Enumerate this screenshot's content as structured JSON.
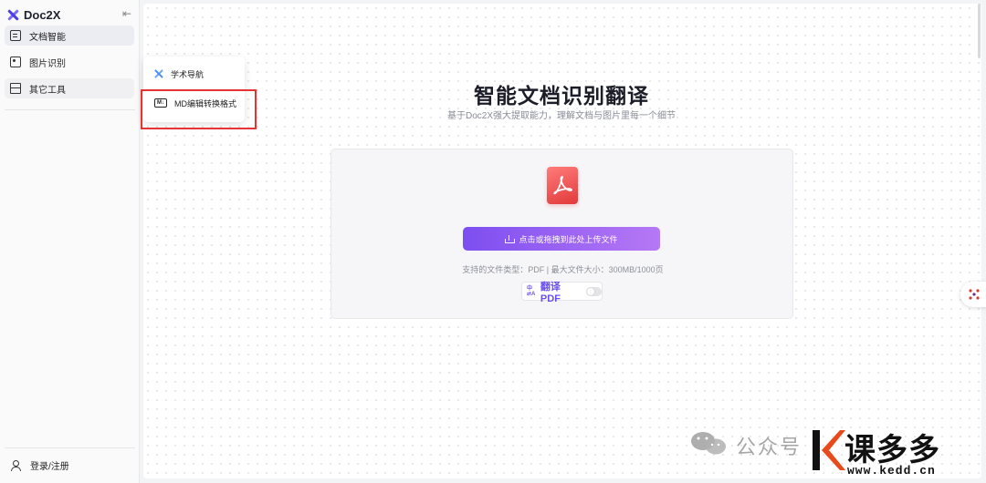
{
  "sidebar": {
    "brand": "Doc2X",
    "collapse_icon": "collapse-left-icon",
    "items": [
      {
        "label": "文档智能",
        "icon": "document-edit-icon",
        "active": true
      },
      {
        "label": "图片识别",
        "icon": "image-scan-icon",
        "active": false
      },
      {
        "label": "其它工具",
        "icon": "toolbox-icon",
        "active": false
      }
    ],
    "login_label": "登录/注册"
  },
  "popup_menu": {
    "items": [
      {
        "label": "学术导航",
        "icon": "sparkle-icon"
      },
      {
        "label": "MD编辑转换格式",
        "icon": "markdown-icon",
        "icon_text": "M↓"
      }
    ]
  },
  "hero": {
    "title": "智能文档识别翻译",
    "subtitle": "基于Doc2X强大提取能力，理解文档与图片里每一个细节"
  },
  "upload": {
    "button_label": "点击或拖拽到此处上传文件",
    "info": "支持的文件类型：PDF  |  最大文件大小：300MB/1000页",
    "translate_label": "翻译 PDF",
    "translate_enabled": false
  },
  "watermark": {
    "wechat_text": "公众号",
    "brand": "课多多",
    "url": "www.kedd.cn"
  },
  "colors": {
    "accent": "#7d4ef0",
    "accent_end": "#b678f5",
    "pdf_red": "#e23a3a",
    "highlight": "#e63333"
  }
}
